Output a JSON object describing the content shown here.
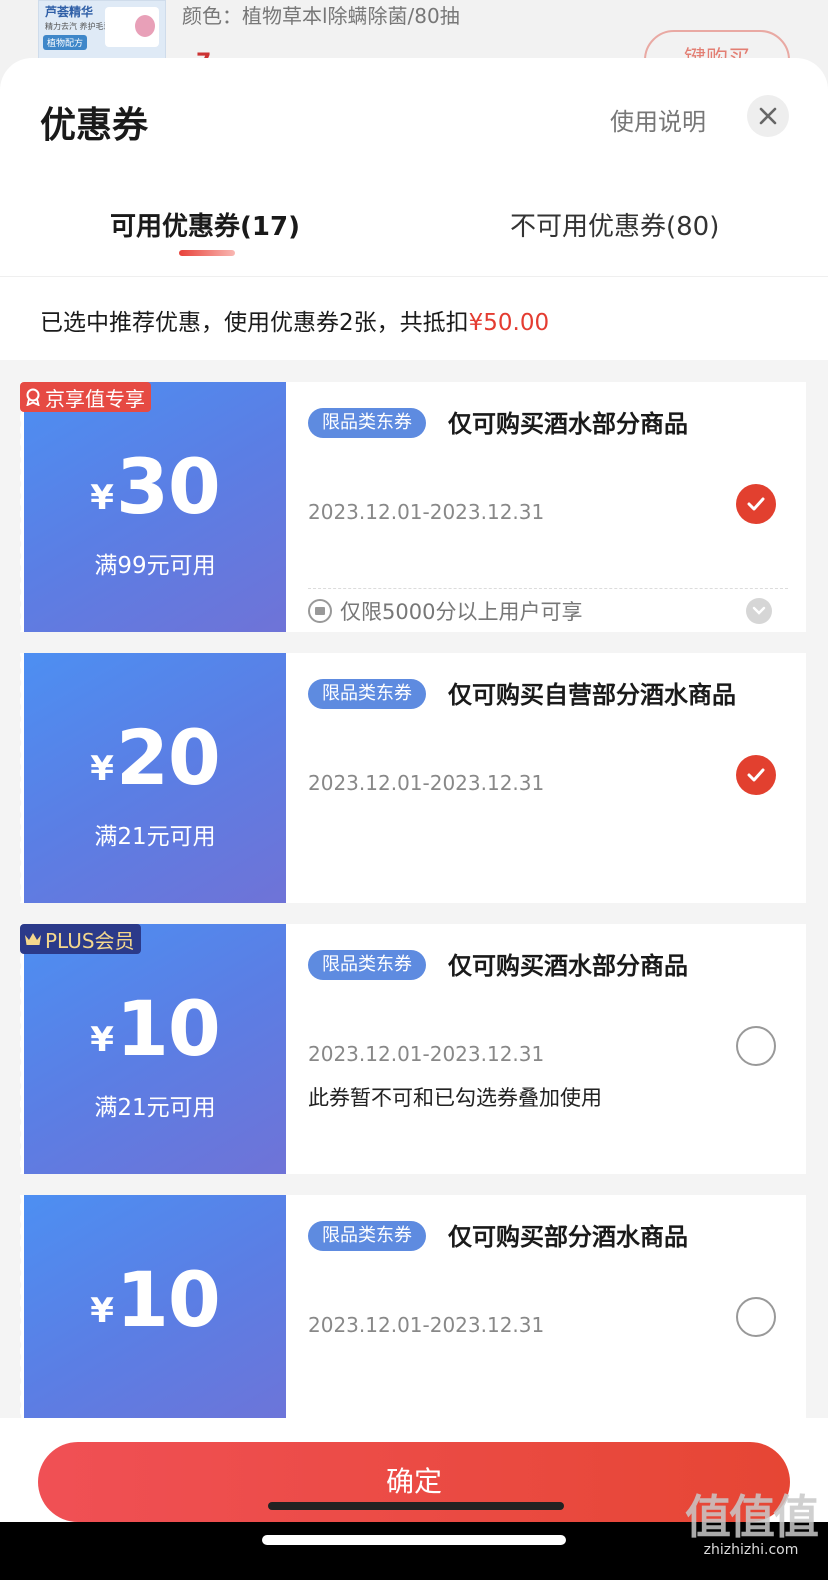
{
  "background": {
    "product_spec": "颜色：植物草本l除螨除菌/80抽",
    "thumb_brand": "芦荟精华",
    "thumb_sub": "精力去汽 养护毛囊",
    "thumb_badge": "植物配方",
    "price_partial": "7",
    "buy_button_partial": "键购买"
  },
  "sheet": {
    "title": "优惠券",
    "help_link": "使用说明",
    "close_icon": "close-icon"
  },
  "tabs": [
    {
      "label": "可用优惠券(17)",
      "active": true
    },
    {
      "label": "不可用优惠券(80)",
      "active": false
    }
  ],
  "summary": {
    "text": "已选中推荐优惠，使用优惠券2张，共抵扣",
    "amount": "¥50.00"
  },
  "coupons": [
    {
      "tag": "京享值专享",
      "tag_icon": "award-icon",
      "yen": "¥",
      "amount": "30",
      "threshold": "满99元可用",
      "badge": "限品类东券",
      "name": "仅可购买酒水部分商品",
      "date": "2023.12.01-2023.12.31",
      "checked": true,
      "limit": "仅限5000分以上用户可享"
    },
    {
      "yen": "¥",
      "amount": "20",
      "threshold": "满21元可用",
      "badge": "限品类东券",
      "name": "仅可购买自营部分酒水商品",
      "date": "2023.12.01-2023.12.31",
      "checked": true
    },
    {
      "tag": "PLUS会员",
      "tag_icon": "crown-icon",
      "yen": "¥",
      "amount": "10",
      "threshold": "满21元可用",
      "badge": "限品类东券",
      "name": "仅可购买酒水部分商品",
      "date": "2023.12.01-2023.12.31",
      "checked": false,
      "note": "此券暂不可和已勾选券叠加使用"
    },
    {
      "yen": "¥",
      "amount": "10",
      "badge": "限品类东券",
      "name": "仅可购买部分酒水商品",
      "date": "2023.12.01-2023.12.31",
      "checked": false
    }
  ],
  "footer": {
    "confirm_label": "确定"
  },
  "watermark": {
    "logo": "值值值",
    "url": "zhizhizhi.com"
  },
  "colors": {
    "accent_red": "#e43c31",
    "coupon_blue": "#5b7ee4",
    "badge_blue": "#5e8be0"
  }
}
